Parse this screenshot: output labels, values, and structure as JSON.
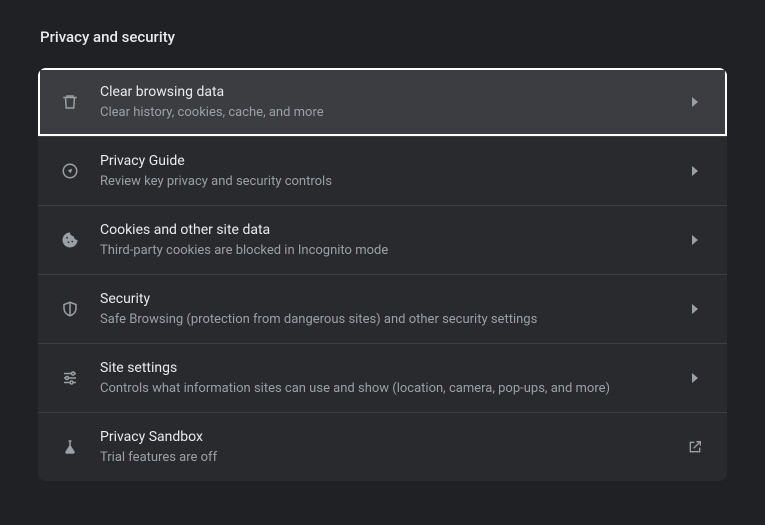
{
  "section": {
    "title": "Privacy and security"
  },
  "rows": {
    "clear": {
      "title": "Clear browsing data",
      "desc": "Clear history, cookies, cache, and more"
    },
    "guide": {
      "title": "Privacy Guide",
      "desc": "Review key privacy and security controls"
    },
    "cookies": {
      "title": "Cookies and other site data",
      "desc": "Third-party cookies are blocked in Incognito mode"
    },
    "security": {
      "title": "Security",
      "desc": "Safe Browsing (protection from dangerous sites) and other security settings"
    },
    "site": {
      "title": "Site settings",
      "desc": "Controls what information sites can use and show (location, camera, pop-ups, and more)"
    },
    "sandbox": {
      "title": "Privacy Sandbox",
      "desc": "Trial features are off"
    }
  }
}
